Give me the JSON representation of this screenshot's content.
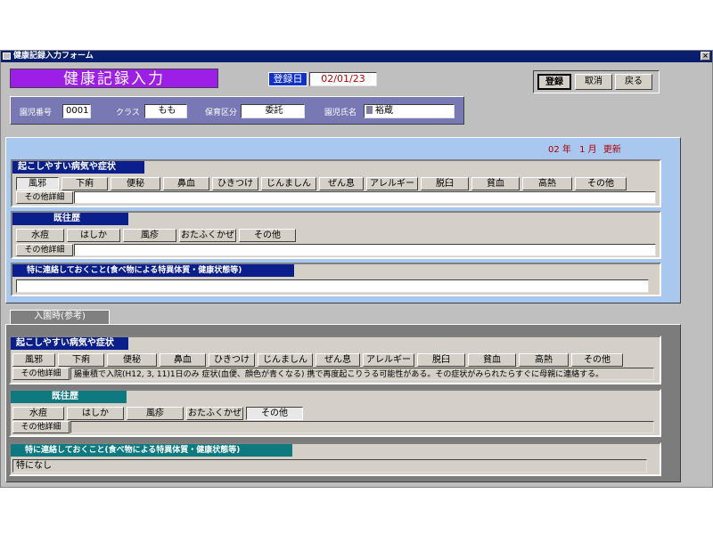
{
  "window": {
    "title": "健康記録入力フォーム",
    "close_glyph": "×"
  },
  "header": {
    "title": "健康記録入力",
    "reg_date_label": "登録日",
    "reg_date_value": "02/01/23",
    "buttons": {
      "register": "登録",
      "cancel": "取消",
      "back": "戻る"
    }
  },
  "info": {
    "id_label": "園児番号",
    "id_value": "0001",
    "class_label": "クラス",
    "class_value": "もも",
    "care_label": "保育区分",
    "care_value": "委託",
    "name_label": "園児氏名",
    "name_value": "裕蔵"
  },
  "current": {
    "update_year": "02",
    "year_unit": "年",
    "update_month": "1",
    "month_unit": "月",
    "update_label": "更新",
    "symptoms": {
      "title": "起こしやすい病気や症状",
      "items": [
        "風邪",
        "下痢",
        "便秘",
        "鼻血",
        "ひきつけ",
        "じんましん",
        "ぜん息",
        "アレルギー",
        "脱臼",
        "貧血",
        "高熱",
        "その他"
      ],
      "detail_label": "その他詳細",
      "detail_value": ""
    },
    "history": {
      "title": "既往歴",
      "items": [
        "水痘",
        "はしか",
        "風疹",
        "おたふくかぜ",
        "その他"
      ],
      "detail_label": "その他詳細",
      "detail_value": ""
    },
    "notes": {
      "title": "特に連絡しておくこと(食べ物による特異体質・健康状態等)",
      "value": ""
    }
  },
  "admission": {
    "tab_label": "入園時(参考)",
    "symptoms": {
      "title": "起こしやすい病気や症状",
      "items": [
        "風邪",
        "下痢",
        "便秘",
        "鼻血",
        "ひきつけ",
        "じんましん",
        "ぜん息",
        "アレルギー",
        "脱臼",
        "貧血",
        "高熱",
        "その他"
      ],
      "detail_label": "その他詳細",
      "detail_value": "腸重積で入院(H12, 3, 11)1日のみ 症状(血便、顔色が青くなる) 携で再度起こりうる可能性がある。その症状がみられたらすぐに母親に連絡する。"
    },
    "history": {
      "title": "既往歴",
      "items": [
        "水痘",
        "はしか",
        "風疹",
        "おたふくかぜ",
        "その他"
      ],
      "detail_label": "その他詳細",
      "detail_value": ""
    },
    "notes": {
      "title": "特に連絡しておくこと(食べ物による特異体質・健康状態等)",
      "value": "特になし"
    }
  }
}
